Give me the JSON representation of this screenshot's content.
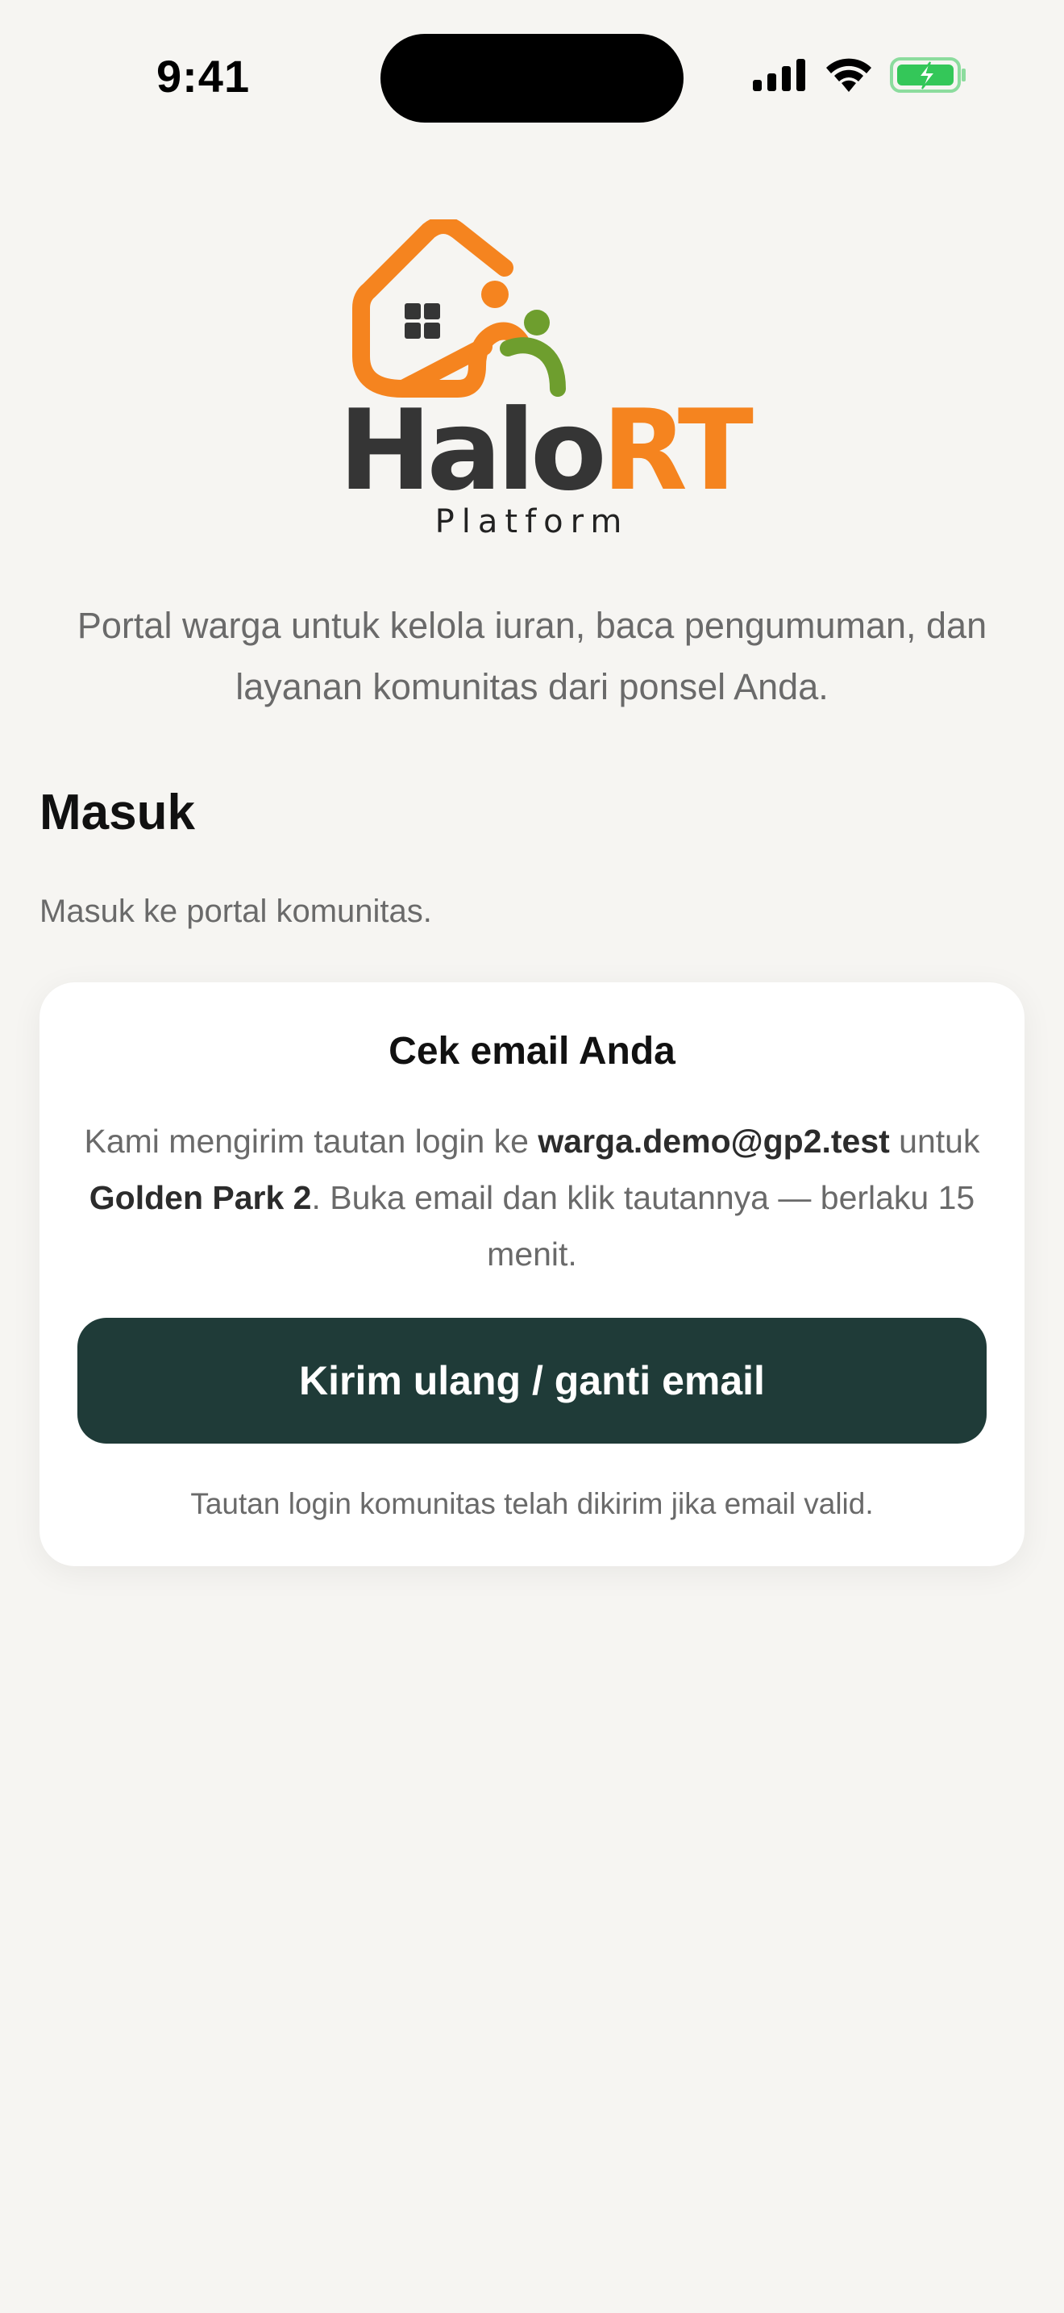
{
  "status_bar": {
    "time": "9:41",
    "icons": [
      "cellular-signal-icon",
      "wifi-icon",
      "battery-charging-icon"
    ]
  },
  "logo": {
    "brand_part1": "Halo",
    "brand_part2": "RT",
    "subtitle": "Platform",
    "colors": {
      "orange": "#f5841f",
      "green": "#6e9e2e",
      "dark": "#353535"
    }
  },
  "intro": {
    "tagline": "Portal warga untuk kelola iuran, baca pengumuman, dan layanan komunitas dari ponsel Anda."
  },
  "login": {
    "title": "Masuk",
    "subtitle": "Masuk ke portal komunitas."
  },
  "card": {
    "title": "Cek email Anda",
    "body_prefix": "Kami mengirim tautan login ke ",
    "email": "warga.demo@gp2.test",
    "body_middle": " untuk ",
    "community": "Golden Park 2",
    "body_suffix": ". Buka email dan klik tautannya — berlaku 15 menit.",
    "button_label": "Kirim ulang / ganti email",
    "note": "Tautan login komunitas telah dikirim jika email valid."
  },
  "colors": {
    "background": "#f6f5f2",
    "primary_button": "#1f3b38",
    "battery_green": "#34c759"
  }
}
